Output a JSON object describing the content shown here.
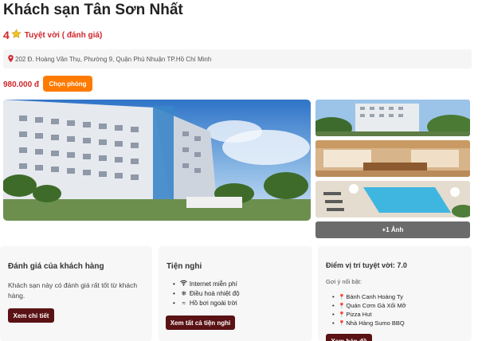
{
  "hotel": {
    "name": "Khách sạn Tân Sơn Nhất",
    "rating_score": "4",
    "rating_text": "Tuyệt vời ( đánh giá)",
    "address": "202 Đ. Hoàng Văn Thụ, Phường 9, Quận Phú Nhuận TP.Hồ Chí Minh",
    "price": "980.000 đ",
    "book_label": "Chọn phòng"
  },
  "gallery": {
    "more_label": "+1 Ảnh"
  },
  "reviews_card": {
    "title": "Đánh giá của khách hàng",
    "description": "Khách sạn này có đánh giá rất tốt từ khách hàng.",
    "button_label": "Xem chi tiết"
  },
  "amenities_card": {
    "title": "Tiện nghi",
    "items": [
      {
        "icon": "wifi-icon",
        "glyph": "📶",
        "label": "Internet miễn phí"
      },
      {
        "icon": "snowflake-icon",
        "glyph": "❄",
        "label": "Điều hoà nhiệt độ"
      },
      {
        "icon": "pool-icon",
        "glyph": "≈",
        "label": "Hồ bơi ngoài trời"
      }
    ],
    "button_label": "Xem tất cả tiện nghi"
  },
  "location_card": {
    "title": "Điểm vị trí tuyệt vời: 7.0",
    "subtitle": "Gợi ý nổi bật:",
    "places": [
      "Bánh Canh Hoàng Ty",
      "Quán Cơm Gà Xối Mỡ",
      "Pizza Hut",
      "Nhà Hàng Sumo BBQ"
    ],
    "button_label": "Xem bản đồ"
  },
  "colors": {
    "accent_red": "#d0252c",
    "orange_button": "#ff7a00",
    "dark_button": "#5a1214",
    "gray_button": "#6b6b6b"
  }
}
